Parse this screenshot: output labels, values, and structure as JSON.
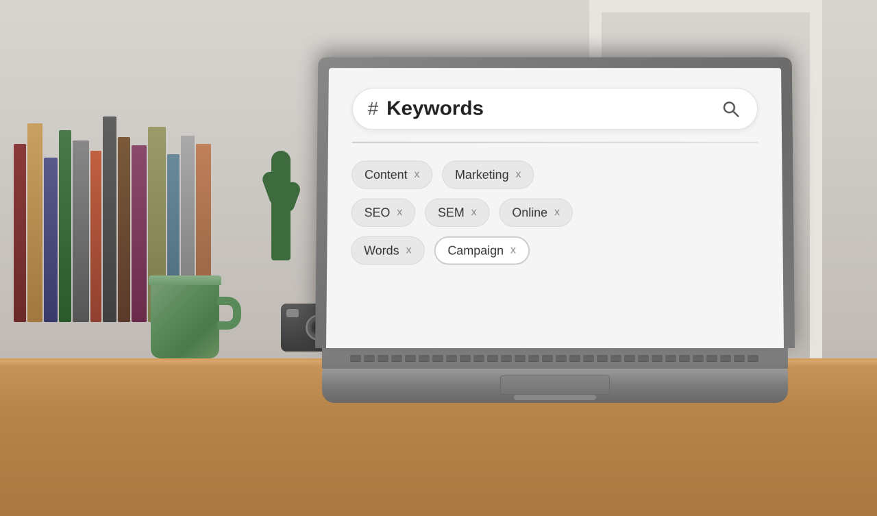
{
  "scene": {
    "background_color": "#c8bfb8",
    "desk_color": "#c8955a",
    "wall_color": "#d0ccc8"
  },
  "laptop": {
    "screen": {
      "search_bar": {
        "hash_symbol": "#",
        "placeholder": "Keywords",
        "search_icon": "🔍"
      },
      "tags": [
        {
          "label": "Content",
          "x": "x",
          "row": 0,
          "selected": false
        },
        {
          "label": "Marketing",
          "x": "x",
          "row": 0,
          "selected": false
        },
        {
          "label": "SEO",
          "x": "x",
          "row": 1,
          "selected": false
        },
        {
          "label": "SEM",
          "x": "x",
          "row": 1,
          "selected": false
        },
        {
          "label": "Online",
          "x": "x",
          "row": 1,
          "selected": false
        },
        {
          "label": "Words",
          "x": "x",
          "row": 2,
          "selected": false
        },
        {
          "label": "Campaign",
          "x": "x",
          "row": 2,
          "selected": true
        }
      ]
    }
  }
}
